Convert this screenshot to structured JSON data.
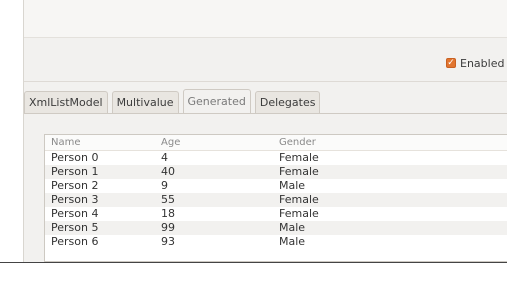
{
  "toolbar": {
    "enabled_label": "Enabled",
    "enabled_checked": true
  },
  "tabs": [
    {
      "label": "XmlListModel",
      "active": false
    },
    {
      "label": "Multivalue",
      "active": false
    },
    {
      "label": "Generated",
      "active": true
    },
    {
      "label": "Delegates",
      "active": false
    }
  ],
  "table": {
    "headers": [
      "Name",
      "Age",
      "Gender"
    ],
    "rows": [
      {
        "name": "Person 0",
        "age": "4",
        "gender": "Female"
      },
      {
        "name": "Person 1",
        "age": "40",
        "gender": "Female"
      },
      {
        "name": "Person 2",
        "age": "9",
        "gender": "Male"
      },
      {
        "name": "Person 3",
        "age": "55",
        "gender": "Female"
      },
      {
        "name": "Person 4",
        "age": "18",
        "gender": "Female"
      },
      {
        "name": "Person 5",
        "age": "99",
        "gender": "Male"
      },
      {
        "name": "Person 6",
        "age": "93",
        "gender": "Male"
      }
    ]
  },
  "colors": {
    "checkbox_accent": "#e1752f"
  }
}
